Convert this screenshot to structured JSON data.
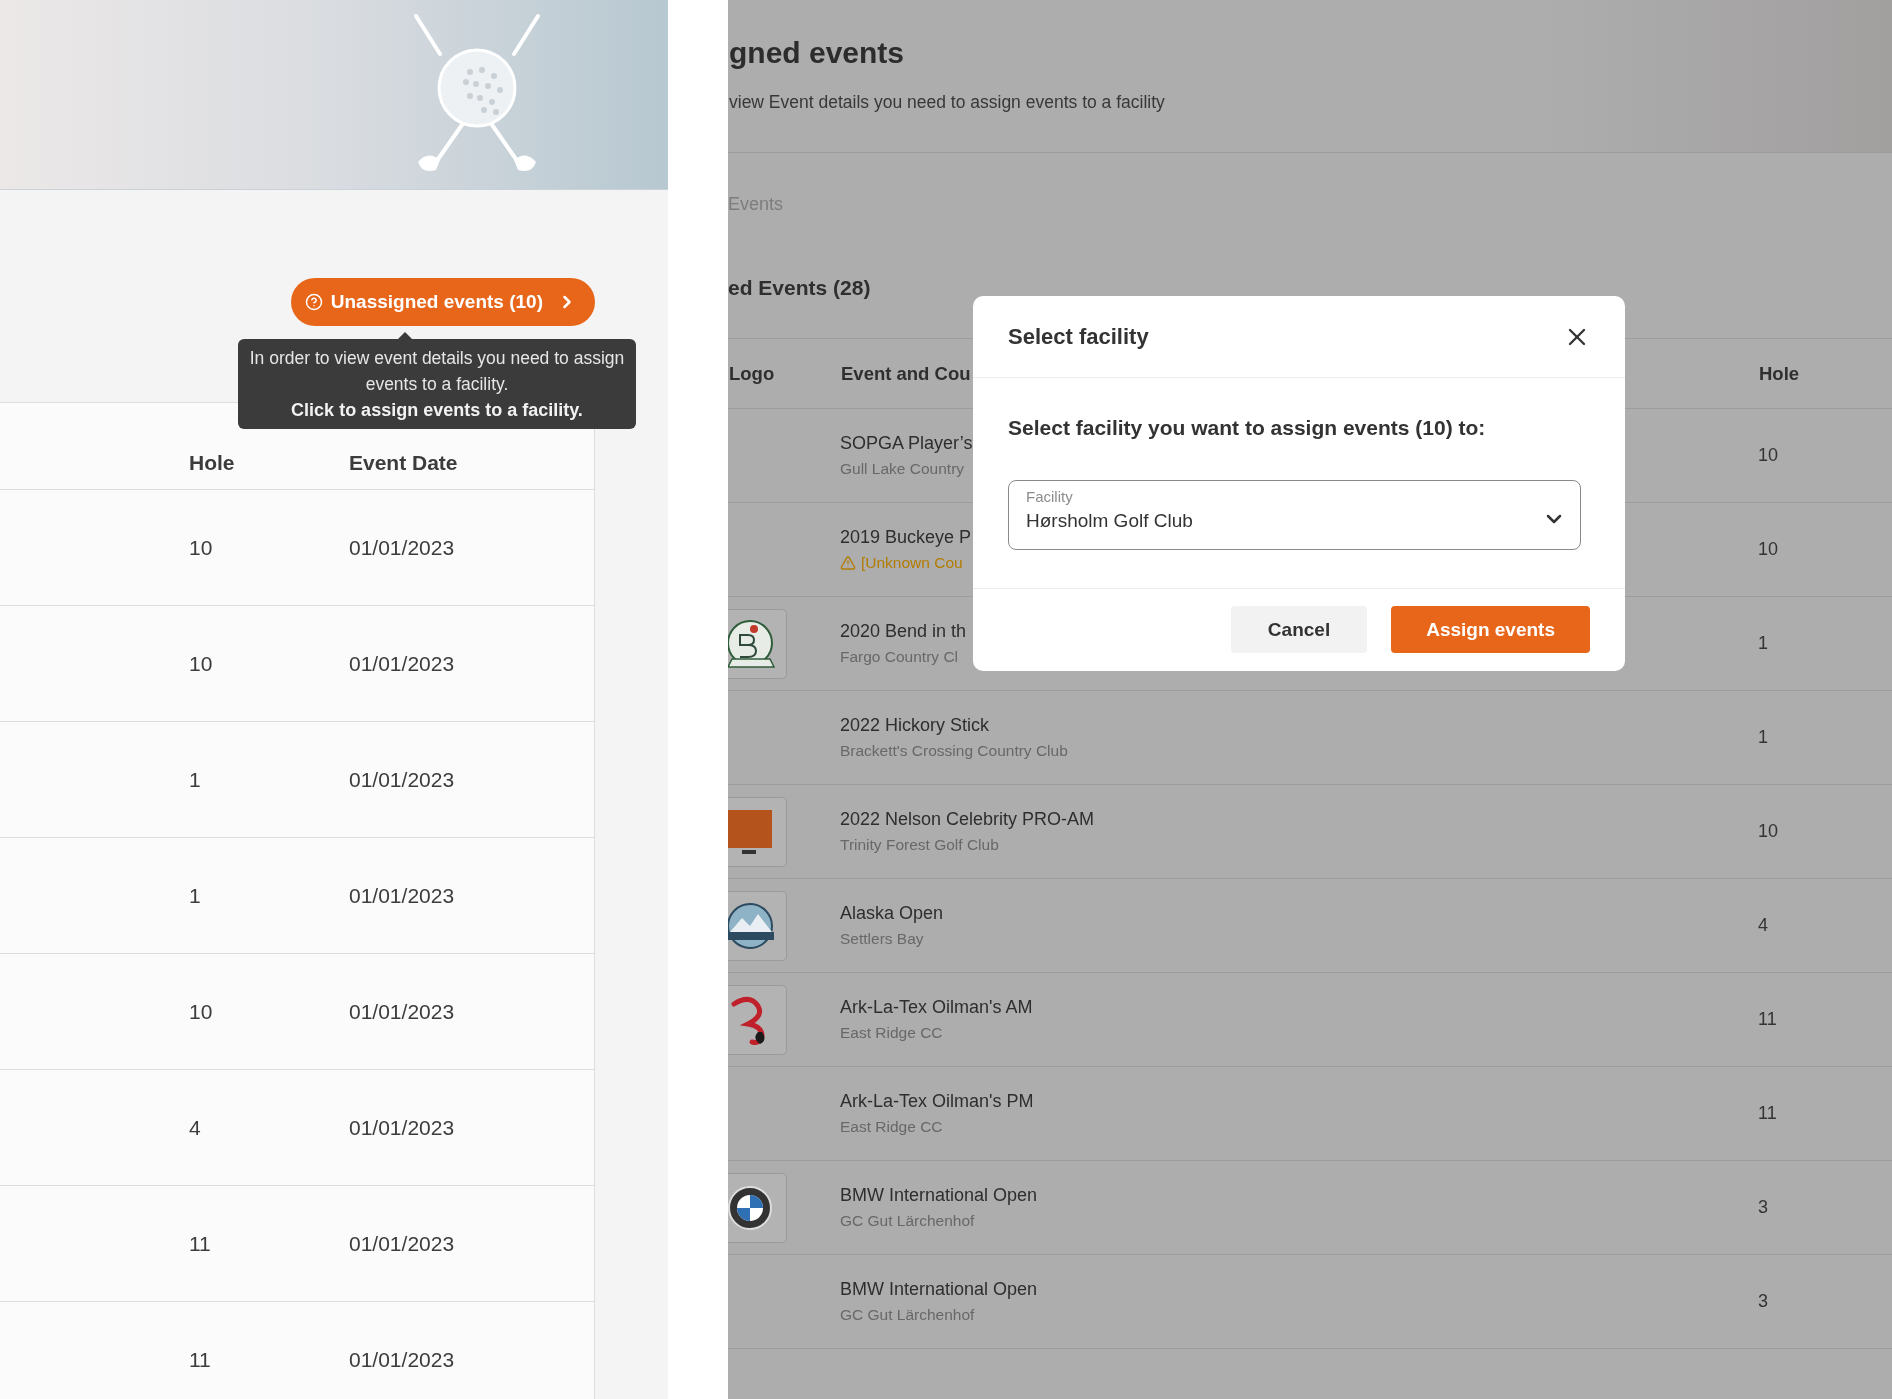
{
  "left_screen": {
    "unassigned_button": {
      "label": "Unassigned events (10)"
    },
    "tooltip": {
      "message": "In order to view event details you need to assign events to a facility.",
      "action": "Click to assign events to a facility."
    },
    "table": {
      "columns": [
        "Hole",
        "Event Date"
      ],
      "rows": [
        {
          "hole": "10",
          "date": "01/01/2023"
        },
        {
          "hole": "10",
          "date": "01/01/2023"
        },
        {
          "hole": "1",
          "date": "01/01/2023"
        },
        {
          "hole": "1",
          "date": "01/01/2023"
        },
        {
          "hole": "10",
          "date": "01/01/2023"
        },
        {
          "hole": "4",
          "date": "01/01/2023"
        },
        {
          "hole": "11",
          "date": "01/01/2023"
        },
        {
          "hole": "11",
          "date": "01/01/2023"
        }
      ]
    }
  },
  "right_screen": {
    "title": "gned events",
    "subtitle": "view Event details you need to assign events to a facility",
    "tab": "Events",
    "section_title": "ed Events (28)",
    "table": {
      "columns": [
        "Logo",
        "Event and Cou",
        "Hole"
      ],
      "rows": [
        {
          "kind": "none",
          "event": "SOPGA Player’s",
          "course": "Gull Lake Country",
          "warning": false,
          "hole": "10"
        },
        {
          "kind": "none",
          "event": "2019 Buckeye P",
          "course": "[Unknown Cou",
          "warning": true,
          "hole": "10"
        },
        {
          "kind": "crest",
          "event": "2020 Bend in th",
          "course": "Fargo Country Cl",
          "warning": false,
          "hole": "1"
        },
        {
          "kind": "none",
          "event": "2022 Hickory Stick",
          "course": "Brackett's Crossing Country Club",
          "warning": false,
          "hole": "1"
        },
        {
          "kind": "monitor",
          "event": "2022 Nelson Celebrity PRO-AM",
          "course": "Trinity Forest Golf Club",
          "warning": false,
          "hole": "10"
        },
        {
          "kind": "mountain",
          "event": "Alaska Open",
          "course": "Settlers Bay",
          "warning": false,
          "hole": "4"
        },
        {
          "kind": "ribbon",
          "event": "Ark-La-Tex Oilman's AM",
          "course": "East Ridge CC",
          "warning": false,
          "hole": "11"
        },
        {
          "kind": "none",
          "event": "Ark-La-Tex Oilman's PM",
          "course": "East Ridge CC",
          "warning": false,
          "hole": "11"
        },
        {
          "kind": "roundel",
          "event": "BMW International Open",
          "course": "GC Gut Lärchenhof",
          "warning": false,
          "hole": "3"
        },
        {
          "kind": "none",
          "event": "BMW International Open",
          "course": "GC Gut Lärchenhof",
          "warning": false,
          "hole": "3"
        }
      ]
    },
    "modal": {
      "title": "Select facility",
      "prompt": "Select facility you want to assign events (10) to:",
      "field": {
        "label": "Facility",
        "value": "Hørsholm Golf Club"
      },
      "buttons": [
        {
          "label": "Cancel",
          "kind": "secondary"
        },
        {
          "label": "Assign events",
          "kind": "primary"
        }
      ]
    }
  }
}
